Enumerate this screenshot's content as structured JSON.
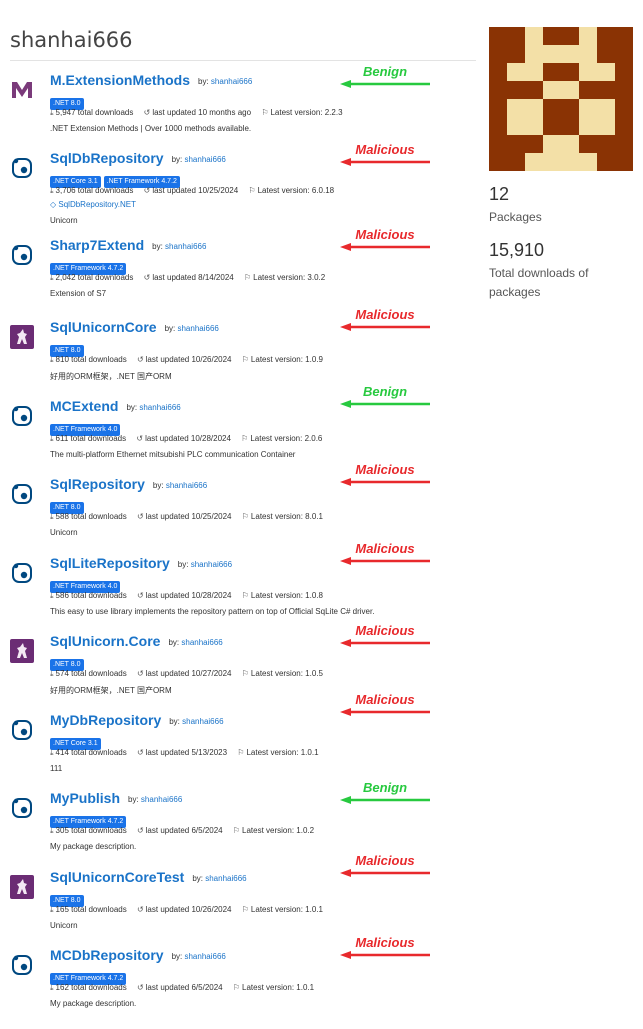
{
  "profile": {
    "username": "shanhai666",
    "packages_count": "12",
    "packages_label": "Packages",
    "downloads_count": "15,910",
    "downloads_label": "Total downloads of packages"
  },
  "colors": {
    "malicious": "#e8292c",
    "benign": "#27c93f",
    "link": "#1a73c8",
    "tag": "#1a73e8"
  },
  "packages": [
    {
      "name": "M.ExtensionMethods",
      "by": "by:",
      "author": "shanhai666",
      "tags": [
        ".NET 8.0"
      ],
      "downloads": "5,947 total downloads",
      "updated": "last updated 10 months ago",
      "version": "Latest version: 2.2.3",
      "repo": "",
      "description": ".NET Extension Methods | Over 1000 methods available.",
      "icon": "m-logo-icon",
      "label": "Benign"
    },
    {
      "name": "SqlDbRepository",
      "by": "by:",
      "author": "shanhai666",
      "tags": [
        ".NET Core 3.1",
        ".NET Framework 4.7.2"
      ],
      "downloads": "3,706 total downloads",
      "updated": "last updated 10/25/2024",
      "version": "Latest version: 6.0.18",
      "repo": "SqlDbRepository.NET",
      "description": "Unicorn",
      "icon": "nuget-icon",
      "label": "Malicious"
    },
    {
      "name": "Sharp7Extend",
      "by": "by:",
      "author": "shanhai666",
      "tags": [
        ".NET Framework 4.7.2"
      ],
      "downloads": "2,042 total downloads",
      "updated": "last updated 8/14/2024",
      "version": "Latest version: 3.0.2",
      "repo": "",
      "description": "Extension of S7",
      "icon": "nuget-icon",
      "label": "Malicious"
    },
    {
      "name": "SqlUnicornCore",
      "by": "by:",
      "author": "shanhai666",
      "tags": [
        ".NET 8.0"
      ],
      "downloads": "810 total downloads",
      "updated": "last updated 10/26/2024",
      "version": "Latest version: 1.0.9",
      "repo": "",
      "description": "好用的ORM框架，.NET 国产ORM",
      "icon": "unicorn-icon",
      "label": "Malicious"
    },
    {
      "name": "MCExtend",
      "by": "by:",
      "author": "shanhai666",
      "tags": [
        ".NET Framework 4.0"
      ],
      "downloads": "611 total downloads",
      "updated": "last updated 10/28/2024",
      "version": "Latest version: 2.0.6",
      "repo": "",
      "description": "The multi-platform Ethernet mitsubishi PLC communication Container",
      "icon": "nuget-icon",
      "label": "Benign"
    },
    {
      "name": "SqlRepository",
      "by": "by:",
      "author": "shanhai666",
      "tags": [
        ".NET 8.0"
      ],
      "downloads": "588 total downloads",
      "updated": "last updated 10/25/2024",
      "version": "Latest version: 8.0.1",
      "repo": "",
      "description": "Unicorn",
      "icon": "nuget-icon",
      "label": "Malicious"
    },
    {
      "name": "SqlLiteRepository",
      "by": "by:",
      "author": "shanhai666",
      "tags": [
        ".NET Framework 4.0"
      ],
      "downloads": "586 total downloads",
      "updated": "last updated 10/28/2024",
      "version": "Latest version: 1.0.8",
      "repo": "",
      "description": "This easy to use library implements the repository pattern on top of Official SqLite C# driver.",
      "icon": "nuget-icon",
      "label": "Malicious"
    },
    {
      "name": "SqlUnicorn.Core",
      "by": "by:",
      "author": "shanhai666",
      "tags": [
        ".NET 8.0"
      ],
      "downloads": "574 total downloads",
      "updated": "last updated 10/27/2024",
      "version": "Latest version: 1.0.5",
      "repo": "",
      "description": "好用的ORM框架，.NET 国产ORM",
      "icon": "unicorn-icon",
      "label": "Malicious"
    },
    {
      "name": "MyDbRepository",
      "by": "by:",
      "author": "shanhai666",
      "tags": [
        ".NET Core 3.1"
      ],
      "downloads": "414 total downloads",
      "updated": "last updated 5/13/2023",
      "version": "Latest version: 1.0.1",
      "repo": "",
      "description": "111",
      "icon": "nuget-icon",
      "label": "Malicious"
    },
    {
      "name": "MyPublish",
      "by": "by:",
      "author": "shanhai666",
      "tags": [
        ".NET Framework 4.7.2"
      ],
      "downloads": "305 total downloads",
      "updated": "last updated 6/5/2024",
      "version": "Latest version: 1.0.2",
      "repo": "",
      "description": "My package description.",
      "icon": "nuget-icon",
      "label": "Benign"
    },
    {
      "name": "SqlUnicornCoreTest",
      "by": "by:",
      "author": "shanhai666",
      "tags": [
        ".NET 8.0"
      ],
      "downloads": "165 total downloads",
      "updated": "last updated 10/26/2024",
      "version": "Latest version: 1.0.1",
      "repo": "",
      "description": "Unicorn",
      "icon": "unicorn-icon",
      "label": "Malicious"
    },
    {
      "name": "MCDbRepository",
      "by": "by:",
      "author": "shanhai666",
      "tags": [
        ".NET Framework 4.7.2"
      ],
      "downloads": "162 total downloads",
      "updated": "last updated 6/5/2024",
      "version": "Latest version: 1.0.1",
      "repo": "",
      "description": "My package description.",
      "icon": "nuget-icon",
      "label": "Malicious"
    }
  ]
}
